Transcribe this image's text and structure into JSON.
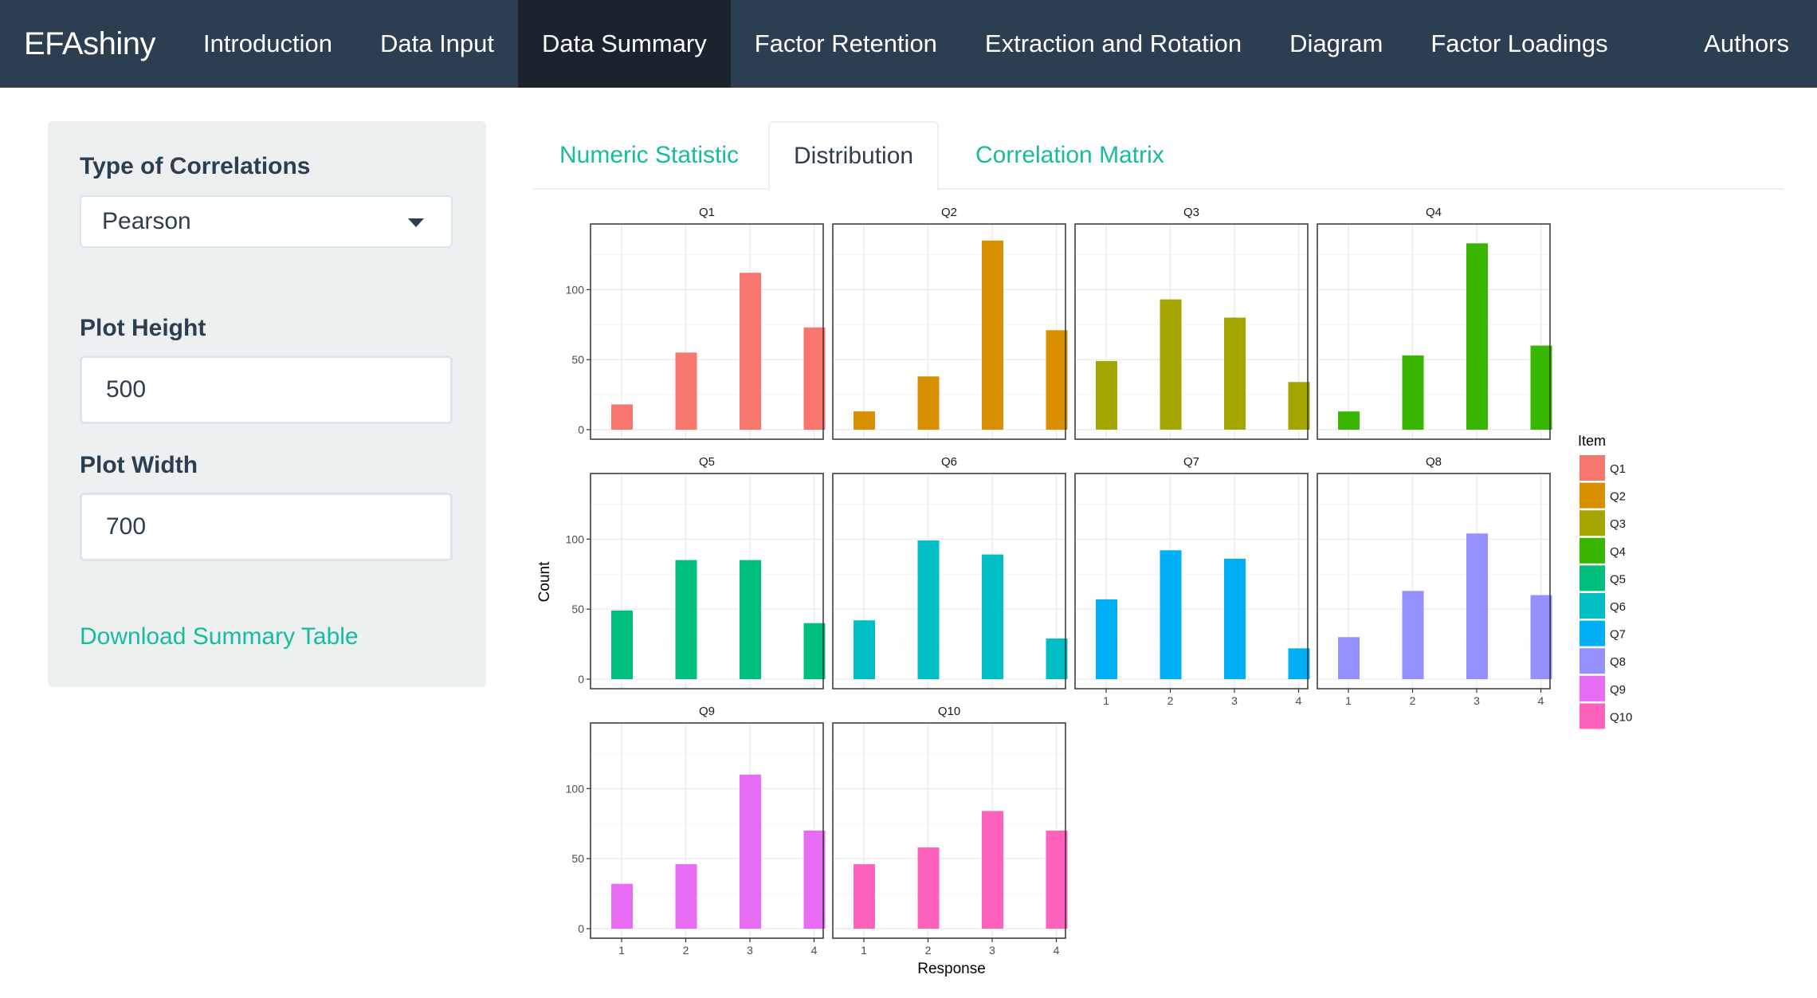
{
  "navbar": {
    "brand": "EFAshiny",
    "items": [
      "Introduction",
      "Data Input",
      "Data Summary",
      "Factor Retention",
      "Extraction and Rotation",
      "Diagram",
      "Factor Loadings"
    ],
    "active": "Data Summary",
    "right_item": "Authors",
    "colors": {
      "background": "#2c3e50",
      "active_background": "#1a242f"
    }
  },
  "sidebar": {
    "correlation_label": "Type of Correlations",
    "correlation_value": "Pearson",
    "height_label": "Plot Height",
    "height_value": "500",
    "width_label": "Plot Width",
    "width_value": "700",
    "download_label": "Download Summary Table"
  },
  "tabs": {
    "items": [
      "Numeric Statistic",
      "Distribution",
      "Correlation Matrix"
    ],
    "active": "Distribution"
  },
  "chart_data": {
    "type": "bar",
    "facet": true,
    "categories": [
      "1",
      "2",
      "3",
      "4"
    ],
    "xlabel": "Response",
    "ylabel": "Count",
    "ylim": [
      0,
      135
    ],
    "yticks": [
      0,
      50,
      100
    ],
    "grid": true,
    "legend": {
      "title": "Item",
      "position": "right"
    },
    "series": [
      {
        "name": "Q1",
        "color": "#F8766D",
        "values": [
          18,
          55,
          112,
          73
        ]
      },
      {
        "name": "Q2",
        "color": "#D89000",
        "values": [
          13,
          38,
          135,
          71
        ]
      },
      {
        "name": "Q3",
        "color": "#A3A500",
        "values": [
          49,
          93,
          80,
          34
        ]
      },
      {
        "name": "Q4",
        "color": "#39B600",
        "values": [
          13,
          53,
          133,
          60
        ]
      },
      {
        "name": "Q5",
        "color": "#00BF7D",
        "values": [
          49,
          85,
          85,
          40
        ]
      },
      {
        "name": "Q6",
        "color": "#00BFC4",
        "values": [
          42,
          99,
          89,
          29
        ]
      },
      {
        "name": "Q7",
        "color": "#00B0F6",
        "values": [
          57,
          92,
          86,
          22
        ]
      },
      {
        "name": "Q8",
        "color": "#9590FF",
        "values": [
          30,
          63,
          104,
          60
        ]
      },
      {
        "name": "Q9",
        "color": "#E76BF3",
        "values": [
          32,
          46,
          110,
          70
        ]
      },
      {
        "name": "Q10",
        "color": "#FF62BC",
        "values": [
          46,
          58,
          84,
          70
        ]
      }
    ]
  }
}
